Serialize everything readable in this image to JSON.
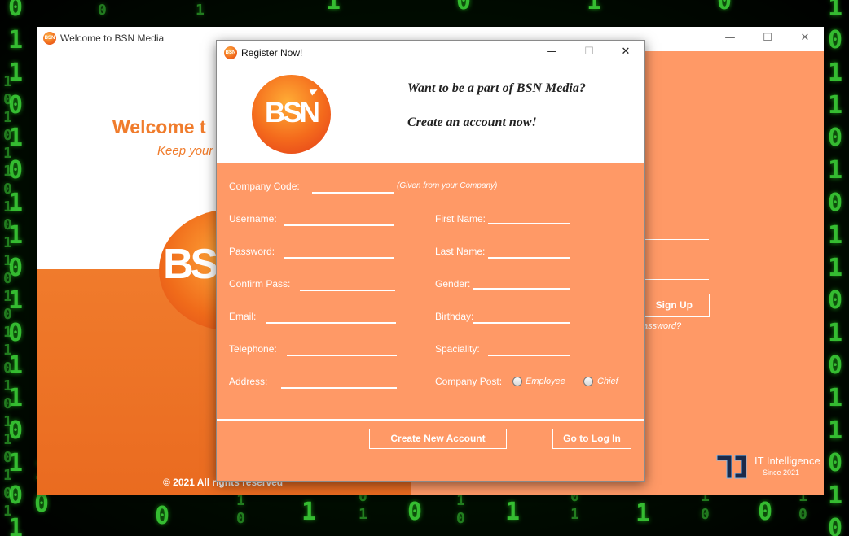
{
  "background": {
    "digits_primary": [
      "0",
      "1",
      "1",
      "0",
      "1",
      "0",
      "1",
      "1",
      "0",
      "1",
      "0",
      "1",
      "1",
      "0",
      "1",
      "0"
    ],
    "accent_color": "#3fdc3a"
  },
  "main_window": {
    "title": "Welcome to BSN Media",
    "icon": "bsn-app-icon",
    "controls": {
      "minimize": "—",
      "maximize": "☐",
      "close": "✕"
    },
    "welcome_text": "Welcome t",
    "subtitle_text": "Keep your",
    "logo_text": "BSN",
    "copyright": "©  2021 All rights reserved",
    "signup_label": "Sign Up",
    "forgot_text": "assword?",
    "brand": {
      "name": "IT Intelligence",
      "since": "Since 2021",
      "icon": "it-intelligence-logo"
    },
    "colors": {
      "accent": "#f07c2c",
      "panel": "#ff9966"
    }
  },
  "register_dialog": {
    "title": "Register Now!",
    "icon": "bsn-app-icon",
    "controls": {
      "minimize": "—",
      "maximize": "☐",
      "close": "✕"
    },
    "logo_text": "BSN",
    "heading_1": "Want to be a part of BSN Media?",
    "heading_2": "Create an account now!",
    "fields": {
      "company_code": {
        "label": "Company Code:",
        "value": "",
        "hint": "(Given from your Company)"
      },
      "username": {
        "label": "Username:",
        "value": ""
      },
      "password": {
        "label": "Password:",
        "value": ""
      },
      "confirm_pass": {
        "label": "Confirm Pass:",
        "value": ""
      },
      "email": {
        "label": "Email:",
        "value": ""
      },
      "telephone": {
        "label": "Telephone:",
        "value": ""
      },
      "address": {
        "label": "Address:",
        "value": ""
      },
      "first_name": {
        "label": "First Name:",
        "value": ""
      },
      "last_name": {
        "label": "Last Name:",
        "value": ""
      },
      "gender": {
        "label": "Gender:",
        "value": ""
      },
      "birthday": {
        "label": "Birthday:",
        "value": ""
      },
      "speciality": {
        "label": "Spaciality:",
        "value": ""
      },
      "company_post": {
        "label": "Company Post:",
        "options": [
          "Employee",
          "Chief"
        ],
        "selected": ""
      }
    },
    "buttons": {
      "create": "Create New Account",
      "login": "Go to Log In"
    },
    "colors": {
      "panel": "#ff9966",
      "text": "#ffffff"
    }
  }
}
